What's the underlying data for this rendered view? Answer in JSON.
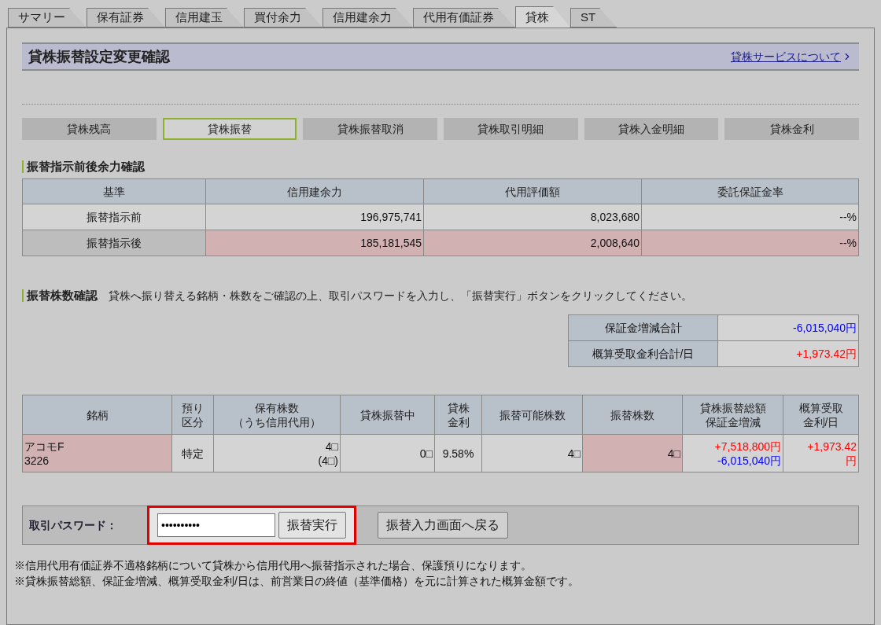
{
  "tabs": [
    {
      "label": "サマリー",
      "selected": false
    },
    {
      "label": "保有証券",
      "selected": false
    },
    {
      "label": "信用建玉",
      "selected": false
    },
    {
      "label": "買付余力",
      "selected": false
    },
    {
      "label": "信用建余力",
      "selected": false
    },
    {
      "label": "代用有価証券",
      "selected": false
    },
    {
      "label": "貸株",
      "selected": true
    },
    {
      "label": "ST",
      "selected": false
    }
  ],
  "page_title": "貸株振替設定変更確認",
  "service_link": "貸株サービスについて",
  "sub_nav": [
    {
      "label": "貸株残高",
      "selected": false
    },
    {
      "label": "貸株振替",
      "selected": true
    },
    {
      "label": "貸株振替取消",
      "selected": false
    },
    {
      "label": "貸株取引明細",
      "selected": false
    },
    {
      "label": "貸株入金明細",
      "selected": false
    },
    {
      "label": "貸株金利",
      "selected": false
    }
  ],
  "capacity_section": {
    "heading": "振替指示前後余力確認",
    "columns": [
      "基準",
      "信用建余力",
      "代用評価額",
      "委託保証金率"
    ],
    "rows": [
      {
        "highlight": false,
        "cells": [
          "振替指示前",
          "196,975,741",
          "8,023,680",
          "--%"
        ]
      },
      {
        "highlight": true,
        "cells": [
          "振替指示後",
          "185,181,545",
          "2,008,640",
          "--%"
        ]
      }
    ]
  },
  "shares_section": {
    "heading": "振替株数確認",
    "instruction": "貸株へ振り替える銘柄・株数をご確認の上、取引パスワードを入力し、「振替実行」ボタンをクリックしてください。",
    "totals": [
      {
        "label": "保証金増減合計",
        "value": "-6,015,040円",
        "color": "#0000ff"
      },
      {
        "label": "概算受取金利合計/日",
        "value": "+1,973.42円",
        "color": "#ff0000"
      }
    ],
    "columns": [
      [
        "銘柄"
      ],
      [
        "預り",
        "区分"
      ],
      [
        "保有株数",
        "（うち信用代用）"
      ],
      [
        "貸株振替中"
      ],
      [
        "貸株",
        "金利"
      ],
      [
        "振替可能株数"
      ],
      [
        "振替株数"
      ],
      [
        "貸株振替総額",
        "保証金増減"
      ],
      [
        "概算受取",
        "金利/日"
      ]
    ],
    "rows": [
      {
        "name": "アコモF",
        "code": "3226",
        "account": "特定",
        "held": "4□",
        "held_margin": "(4□)",
        "lending": "0□",
        "rate": "9.58%",
        "available": "4□",
        "transfer": "4□",
        "total_amount": "+7,518,800円",
        "margin_change": "-6,015,040円",
        "interest": "+1,973.42",
        "interest_unit": "円"
      }
    ]
  },
  "password": {
    "label": "取引パスワード：",
    "value": "••••••••••",
    "highlighted": true
  },
  "buttons": [
    "振替実行",
    "振替入力画面へ戻る"
  ],
  "notes": [
    "※信用代用有価証券不適格銘柄について貸株から信用代用へ振替指示された場合、保護預りになります。",
    "※貸株振替総額、保証金増減、概算受取金利/日は、前営業日の終値（基準価格）を元に計算された概算金額です。"
  ]
}
